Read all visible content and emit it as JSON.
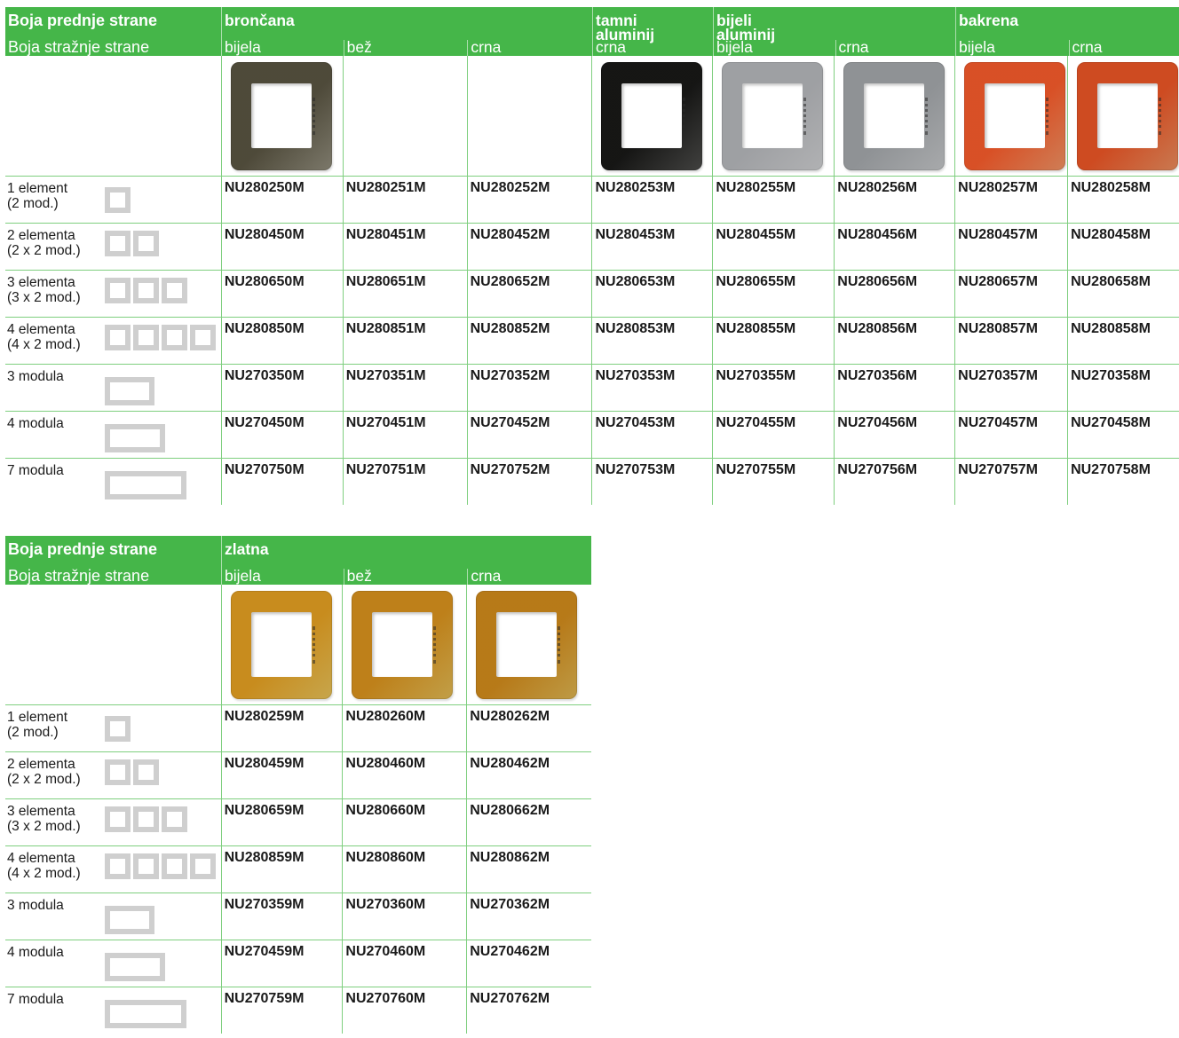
{
  "colors": {
    "header_green": "#45b649",
    "grid_line": "#7fcf7f",
    "frame_gray": "#cfcfcf"
  },
  "table1": {
    "front_label": "Boja prednje strane",
    "back_label": "Boja stražnje strane",
    "groups": [
      {
        "name": "brončana",
        "backs": [
          "bijela",
          "bež",
          "crna"
        ]
      },
      {
        "name": "tamni\naluminij",
        "backs": [
          "crna"
        ]
      },
      {
        "name": "bijeli\naluminij",
        "backs": [
          "bijela",
          "crna"
        ]
      },
      {
        "name": "bakrena",
        "backs": [
          "bijela",
          "crna"
        ]
      }
    ],
    "plates": [
      {
        "color": "#8d8979",
        "icon": "bronze-cover-plate"
      },
      null,
      null,
      {
        "color": "#4a4a48",
        "icon": "dark-aluminium-cover-plate"
      },
      {
        "color": "#c9cacc",
        "icon": "white-aluminium-cover-plate"
      },
      {
        "color": "#bfc1c3",
        "icon": "white-aluminium-cover-plate"
      },
      {
        "color": "#eb8f62",
        "icon": "copper-cover-plate"
      },
      {
        "color": "#e58a5c",
        "icon": "copper-cover-plate"
      }
    ],
    "rows": [
      {
        "label": "1 element\n(2 mod.)",
        "codes": [
          "NU280250M",
          "NU280251M",
          "NU280252M",
          "NU280253M",
          "NU280255M",
          "NU280256M",
          "NU280257M",
          "NU280258M"
        ]
      },
      {
        "label": "2 elementa\n(2 x 2 mod.)",
        "codes": [
          "NU280450M",
          "NU280451M",
          "NU280452M",
          "NU280453M",
          "NU280455M",
          "NU280456M",
          "NU280457M",
          "NU280458M"
        ]
      },
      {
        "label": "3 elementa\n(3 x 2 mod.)",
        "codes": [
          "NU280650M",
          "NU280651M",
          "NU280652M",
          "NU280653M",
          "NU280655M",
          "NU280656M",
          "NU280657M",
          "NU280658M"
        ]
      },
      {
        "label": "4 elementa\n(4 x 2 mod.)",
        "codes": [
          "NU280850M",
          "NU280851M",
          "NU280852M",
          "NU280853M",
          "NU280855M",
          "NU280856M",
          "NU280857M",
          "NU280858M"
        ]
      },
      {
        "label": "3 modula",
        "codes": [
          "NU270350M",
          "NU270351M",
          "NU270352M",
          "NU270353M",
          "NU270355M",
          "NU270356M",
          "NU270357M",
          "NU270358M"
        ]
      },
      {
        "label": "4 modula",
        "codes": [
          "NU270450M",
          "NU270451M",
          "NU270452M",
          "NU270453M",
          "NU270455M",
          "NU270456M",
          "NU270457M",
          "NU270458M"
        ]
      },
      {
        "label": "7 modula",
        "codes": [
          "NU270750M",
          "NU270751M",
          "NU270752M",
          "NU270753M",
          "NU270755M",
          "NU270756M",
          "NU270757M",
          "NU270758M"
        ]
      }
    ]
  },
  "table2": {
    "front_label": "Boja prednje strane",
    "back_label": "Boja stražnje strane",
    "groups": [
      {
        "name": "zlatna",
        "backs": [
          "bijela",
          "bež",
          "crna"
        ]
      }
    ],
    "plates": [
      {
        "color": "#e2bd57",
        "icon": "gold-cover-plate"
      },
      {
        "color": "#dcb552",
        "icon": "gold-cover-plate"
      },
      {
        "color": "#d8b04f",
        "icon": "gold-cover-plate"
      }
    ],
    "rows": [
      {
        "label": "1 element\n(2 mod.)",
        "codes": [
          "NU280259M",
          "NU280260M",
          "NU280262M"
        ]
      },
      {
        "label": "2 elementa\n(2 x 2 mod.)",
        "codes": [
          "NU280459M",
          "NU280460M",
          "NU280462M"
        ]
      },
      {
        "label": "3 elementa\n(3 x 2 mod.)",
        "codes": [
          "NU280659M",
          "NU280660M",
          "NU280662M"
        ]
      },
      {
        "label": "4 elementa\n(4 x 2 mod.)",
        "codes": [
          "NU280859M",
          "NU280860M",
          "NU280862M"
        ]
      },
      {
        "label": "3 modula",
        "codes": [
          "NU270359M",
          "NU270360M",
          "NU270362M"
        ]
      },
      {
        "label": "4 modula",
        "codes": [
          "NU270459M",
          "NU270460M",
          "NU270462M"
        ]
      },
      {
        "label": "7 modula",
        "codes": [
          "NU270759M",
          "NU270760M",
          "NU270762M"
        ]
      }
    ]
  }
}
